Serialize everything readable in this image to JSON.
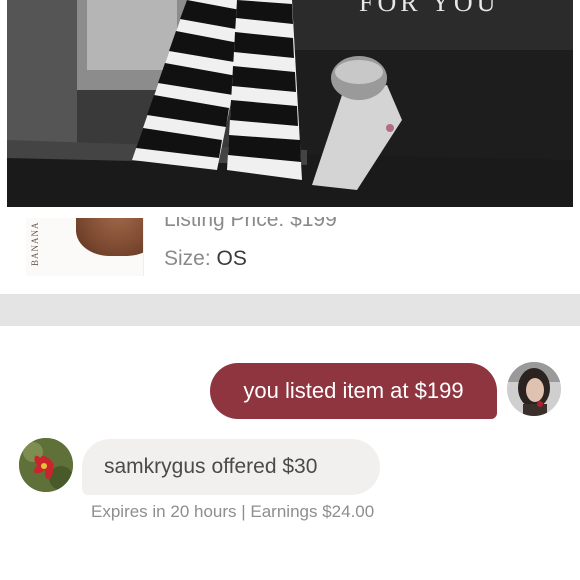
{
  "photo": {
    "caption": "FOR YOU",
    "alt": "black and white photo"
  },
  "listing": {
    "brand": "BANANA",
    "price_label": "Listing Price:",
    "price_value": "$199",
    "size_label": "Size:",
    "size_value": "OS"
  },
  "chat": {
    "outgoing_message": "you listed item at $199",
    "incoming_user": "samkrygus",
    "incoming_text": "offered $30",
    "expires_text": "Expires in 20 hours | Earnings $24.00"
  },
  "colors": {
    "outgoing_bubble": "#8f3540",
    "incoming_bubble": "#f1f0ef",
    "divider": "#e4e4e4"
  }
}
